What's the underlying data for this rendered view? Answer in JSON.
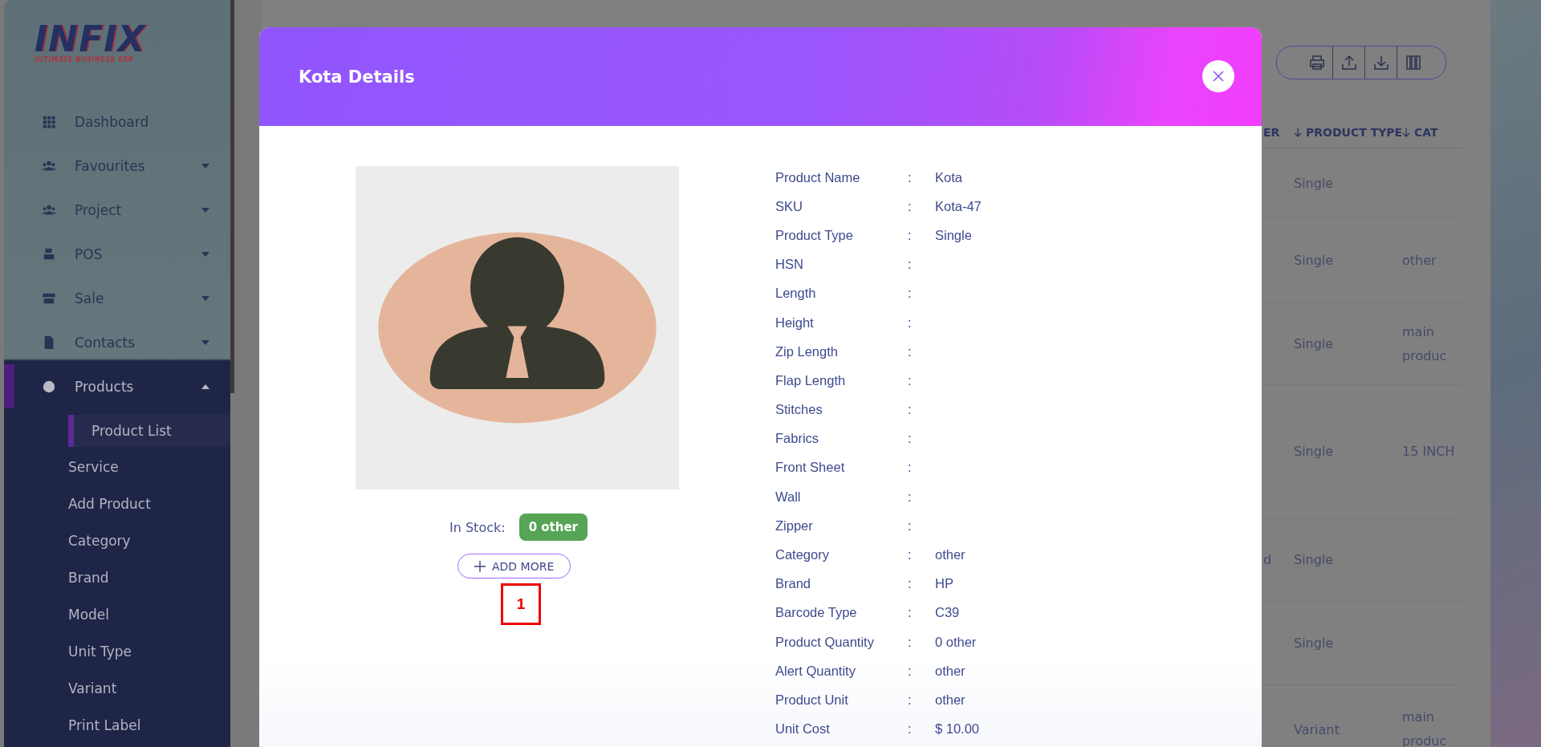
{
  "sidebar": {
    "logo": {
      "name": "INFIX",
      "tagline": "ULTIMATE BUSINESS ERP"
    },
    "items": [
      {
        "label": "Dashboard",
        "kind": "link"
      },
      {
        "label": "Favourites",
        "kind": "group",
        "expanded": false
      },
      {
        "label": "Project",
        "kind": "group",
        "expanded": false
      },
      {
        "label": "POS",
        "kind": "group",
        "expanded": false
      },
      {
        "label": "Sale",
        "kind": "group",
        "expanded": false
      },
      {
        "label": "Contacts",
        "kind": "group",
        "expanded": false
      },
      {
        "label": "Products",
        "kind": "group",
        "expanded": true,
        "children": [
          {
            "label": "Product List",
            "selected": true
          },
          {
            "label": "Service",
            "selected": false
          },
          {
            "label": "Add Product",
            "selected": false
          },
          {
            "label": "Category",
            "selected": false
          },
          {
            "label": "Brand",
            "selected": false
          },
          {
            "label": "Model",
            "selected": false
          },
          {
            "label": "Unit Type",
            "selected": false
          },
          {
            "label": "Variant",
            "selected": false
          },
          {
            "label": "Print Label",
            "selected": false
          }
        ]
      }
    ]
  },
  "table": {
    "columns": [
      "ER",
      "PRODUCT TYPE",
      "CAT"
    ],
    "rows": [
      {
        "product_type": "Single"
      },
      {
        "product_type": "Single",
        "category": "other"
      },
      {
        "product_type": "Single",
        "category": "main produc"
      },
      {
        "product_type": "Single",
        "category": "15 INCH"
      },
      {
        "column_1": "d",
        "product_type": "Single"
      },
      {
        "product_type": "Single"
      },
      {
        "product_type": "Variant",
        "category": "main produc"
      }
    ]
  },
  "modal": {
    "title": "Kota Details",
    "details": [
      {
        "label": "Product Name",
        "value": "Kota"
      },
      {
        "label": "SKU",
        "value": "Kota-47"
      },
      {
        "label": "Product Type",
        "value": "Single"
      },
      {
        "label": "HSN"
      },
      {
        "label": "Length"
      },
      {
        "label": "Height"
      },
      {
        "label": "Zip Length"
      },
      {
        "label": "Flap Length"
      },
      {
        "label": "Stitches"
      },
      {
        "label": "Fabrics"
      },
      {
        "label": "Front Sheet"
      },
      {
        "label": "Wall"
      },
      {
        "label": "Zipper"
      },
      {
        "label": "Category",
        "value": "other"
      },
      {
        "label": "Brand",
        "value": "HP"
      },
      {
        "label": "Barcode Type",
        "value": "C39"
      },
      {
        "label": "Product Quantity",
        "value": "0 other"
      },
      {
        "label": "Alert Quantity",
        "value": "other"
      },
      {
        "label": "Product Unit",
        "value": "other"
      },
      {
        "label": "Unit Cost",
        "value": "$ 10.00"
      }
    ],
    "separator": ":",
    "stock_label": "In Stock:",
    "stock_badge": "0 other",
    "add_button": "ADD MORE",
    "marker": "1"
  }
}
